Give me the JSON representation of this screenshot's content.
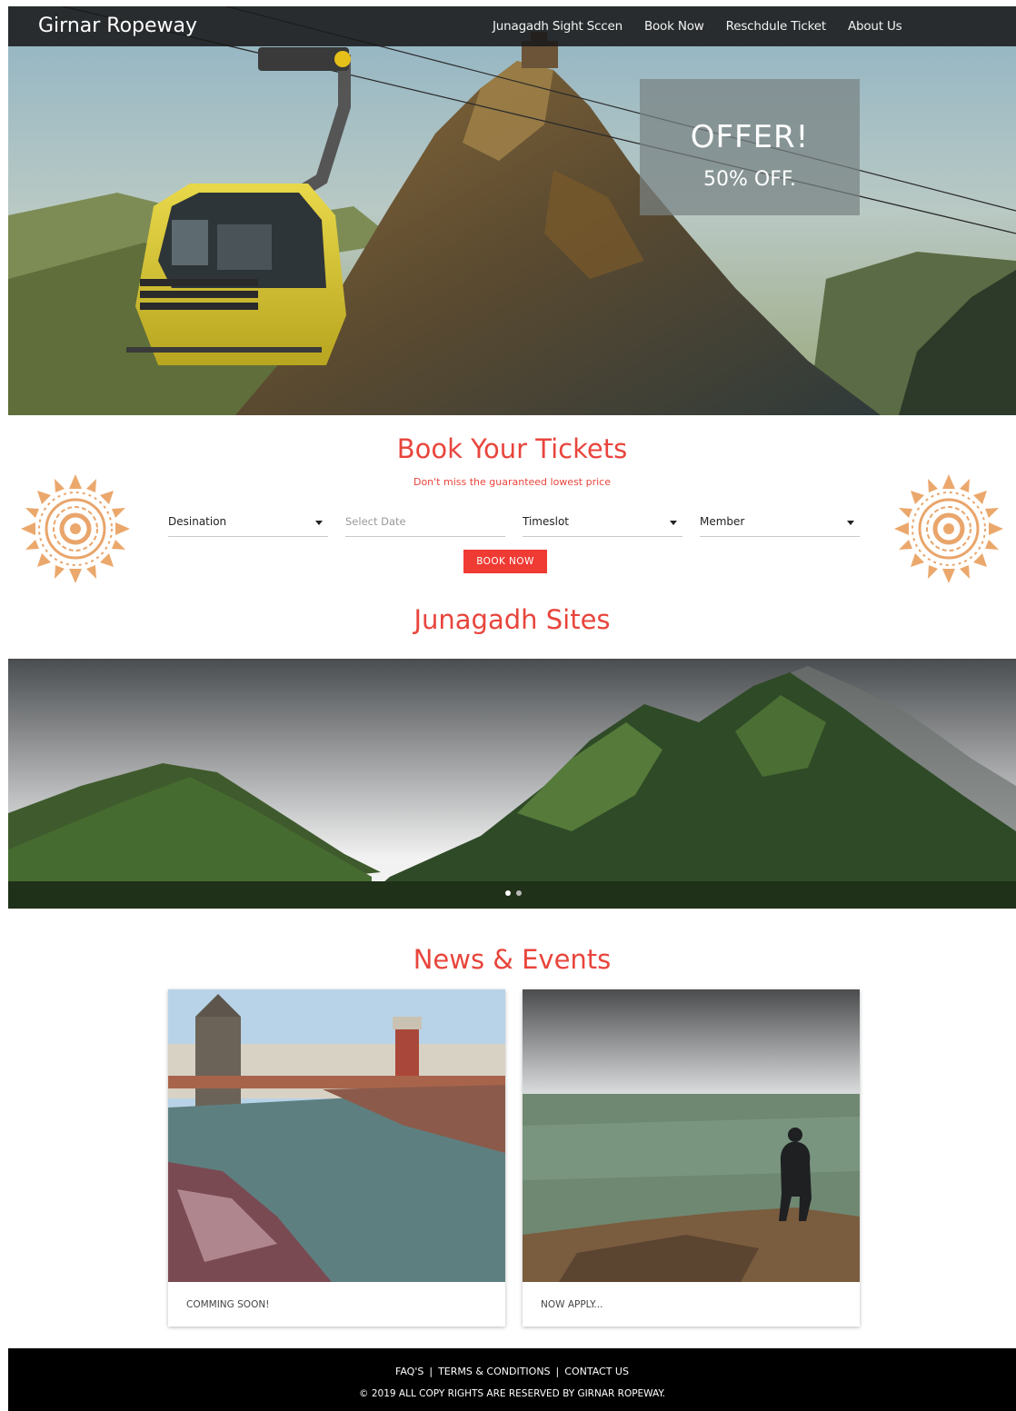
{
  "navbar": {
    "brand": "Girnar Ropeway",
    "links": [
      "Junagadh Sight Sccen",
      "Book Now",
      "Reschdule Ticket",
      "About Us"
    ]
  },
  "offer": {
    "title": "OFFER!",
    "subtitle": "50% OFF."
  },
  "booking": {
    "title": "Book Your Tickets",
    "subtitle": "Don't miss the guaranteed lowest price",
    "destination": "Desination",
    "date_placeholder": "Select Date",
    "timeslot": "Timeslot",
    "member": "Member",
    "button": "BOOK NOW"
  },
  "sites": {
    "title": "Junagadh Sites",
    "slide_count": 2,
    "active_slide": 1
  },
  "news": {
    "title": "News & Events",
    "cards": [
      {
        "caption": "COMMING SOON!"
      },
      {
        "caption": "NOW APPLY..."
      }
    ]
  },
  "footer": {
    "links": [
      "FAQ'S",
      "TERMS & CONDITIONS",
      "CONTACT US"
    ],
    "copyright": "© 2019 ALL COPY RIGHTS ARE RESERVED BY GIRNAR ROPEWAY."
  },
  "colors": {
    "accent": "#e8453c",
    "button": "#ef3b33",
    "navbar": "#191919",
    "footer": "#000000"
  }
}
